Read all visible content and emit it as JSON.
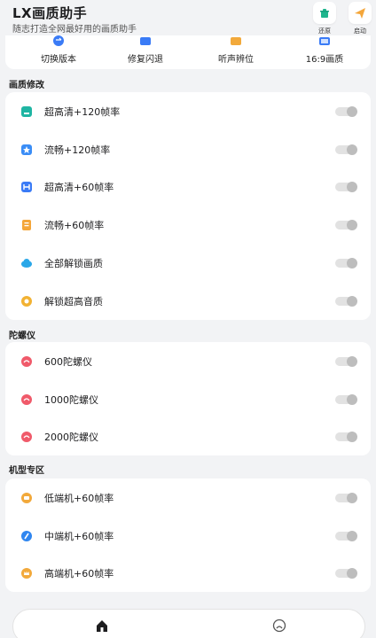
{
  "header": {
    "title": "LX画质助手",
    "subtitle": "随志打造全网最好用的画质助手",
    "restore_label": "还原",
    "start_label": "启动"
  },
  "quick_actions": [
    {
      "label": "切换版本",
      "icon": "swap-icon",
      "color": "#3a7bf6"
    },
    {
      "label": "修复闪退",
      "icon": "repair-icon",
      "color": "#3a7bf6"
    },
    {
      "label": "听声辨位",
      "icon": "sound-icon",
      "color": "#f2a93b"
    },
    {
      "label": "16:9画质",
      "icon": "screen-icon",
      "color": "#3a7bf6"
    }
  ],
  "sections": {
    "quality": {
      "title": "画质修改",
      "items": [
        {
          "label": "超高清+120帧率",
          "icon": "teal-square-icon",
          "color": "#1fb5a3"
        },
        {
          "label": "流畅+120帧率",
          "icon": "blue-star-icon",
          "color": "#3a8df6"
        },
        {
          "label": "超高清+60帧率",
          "icon": "blue-hd-icon",
          "color": "#3a7bf6"
        },
        {
          "label": "流畅+60帧率",
          "icon": "orange-doc-icon",
          "color": "#f4a63a"
        },
        {
          "label": "全部解锁画质",
          "icon": "cloud-icon",
          "color": "#2aa7e8"
        },
        {
          "label": "解锁超高音质",
          "icon": "music-icon",
          "color": "#f2b233"
        }
      ]
    },
    "gyro": {
      "title": "陀螺仪",
      "items": [
        {
          "label": "600陀螺仪",
          "icon": "gyro-icon",
          "color": "#f05a6a"
        },
        {
          "label": "1000陀螺仪",
          "icon": "gyro-icon",
          "color": "#f05a6a"
        },
        {
          "label": "2000陀螺仪",
          "icon": "gyro-icon",
          "color": "#f05a6a"
        }
      ]
    },
    "device": {
      "title": "机型专区",
      "items": [
        {
          "label": "低端机+60帧率",
          "icon": "chat-icon",
          "color": "#f2a93b"
        },
        {
          "label": "中端机+60帧率",
          "icon": "rocket-icon",
          "color": "#2f86f0"
        },
        {
          "label": "高端机+60帧率",
          "icon": "crown-icon",
          "color": "#f2a93b"
        }
      ]
    }
  },
  "colors": {
    "toggle_off_track": "#e2e2e2",
    "toggle_off_knob": "#bdbdbd",
    "background": "#f2f3f5"
  }
}
